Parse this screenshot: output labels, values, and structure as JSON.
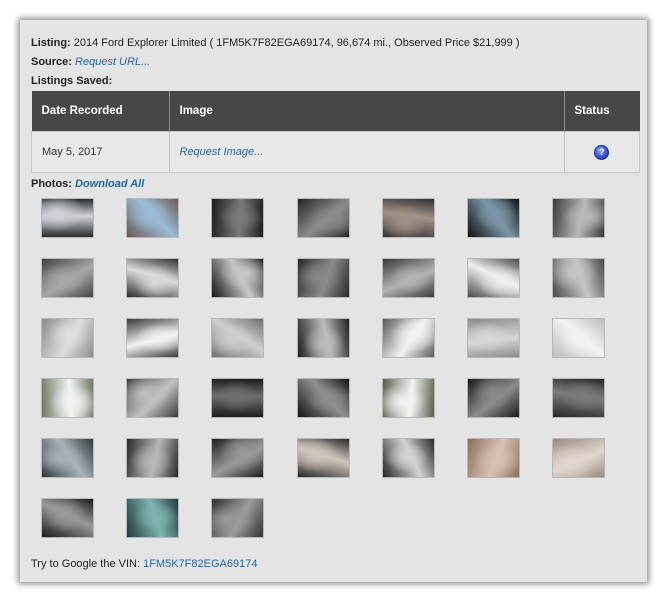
{
  "listing": {
    "label": "Listing:",
    "text": "2014 Ford Explorer Limited ( 1FM5K7F82EGA69174, 96,674 mi., Observed Price $21,999 )"
  },
  "source": {
    "label": "Source:",
    "link": "Request URL..."
  },
  "saved": {
    "label": "Listings Saved:"
  },
  "table": {
    "headers": [
      "Date Recorded",
      "Image",
      "Status"
    ],
    "rows": [
      {
        "date": "May 5, 2017",
        "image_link": "Request Image...",
        "status_icon": "question-icon",
        "status_glyph": "?"
      }
    ]
  },
  "photos": {
    "label": "Photos:",
    "download": "Download All",
    "items": [
      {
        "subject": "ignition-button",
        "c1": "#2a2a2a",
        "c2": "#cfd3d8"
      },
      {
        "subject": "sunroof",
        "c1": "#6a5a52",
        "c2": "#9bbcd6"
      },
      {
        "subject": "door-panel",
        "c1": "#1f1f1f",
        "c2": "#7a7a7a"
      },
      {
        "subject": "door-panel",
        "c1": "#262626",
        "c2": "#8c8c8c"
      },
      {
        "subject": "door-panel",
        "c1": "#333333",
        "c2": "#a29286"
      },
      {
        "subject": "backup-camera-screen",
        "c1": "#111111",
        "c2": "#7c98a8"
      },
      {
        "subject": "rear-seats",
        "c1": "#3a3a3a",
        "c2": "#b9b9b9"
      },
      {
        "subject": "rear-seats",
        "c1": "#444444",
        "c2": "#a8a8a8"
      },
      {
        "subject": "door-open",
        "c1": "#2f2f2f",
        "c2": "#dcdcdc"
      },
      {
        "subject": "gauge-cluster",
        "c1": "#141414",
        "c2": "#c8c8c8"
      },
      {
        "subject": "cabin-interior",
        "c1": "#2b2b2b",
        "c2": "#8a8a8a"
      },
      {
        "subject": "cargo-seats",
        "c1": "#3b3b3b",
        "c2": "#b3b3b3"
      },
      {
        "subject": "rear-exterior",
        "c1": "#4b4b4b",
        "c2": "#efefef"
      },
      {
        "subject": "rear-seats",
        "c1": "#4a4a4a",
        "c2": "#c6c6c6"
      },
      {
        "subject": "cargo-area",
        "c1": "#8d8d8d",
        "c2": "#dedede"
      },
      {
        "subject": "front-exterior",
        "c1": "#3c3c3c",
        "c2": "#f2f2f2"
      },
      {
        "subject": "third-row",
        "c1": "#6e6e6e",
        "c2": "#cfcfcf"
      },
      {
        "subject": "wheel",
        "c1": "#202020",
        "c2": "#bdbdbd"
      },
      {
        "subject": "front-exterior",
        "c1": "#5a5a5a",
        "c2": "#f4f4f4"
      },
      {
        "subject": "rear-seats",
        "c1": "#8c8c8c",
        "c2": "#d7d7d7"
      },
      {
        "subject": "window-sticker",
        "c1": "#bdbdbd",
        "c2": "#f3f3f3"
      },
      {
        "subject": "side-exterior",
        "c1": "#6f7a66",
        "c2": "#f4f4f4"
      },
      {
        "subject": "front-seats",
        "c1": "#3c3c3c",
        "c2": "#c2c2c2"
      },
      {
        "subject": "steering-controls",
        "c1": "#1c1c1c",
        "c2": "#6f6f6f"
      },
      {
        "subject": "center-console",
        "c1": "#151515",
        "c2": "#8f8f8f"
      },
      {
        "subject": "front-exterior",
        "c1": "#59604f",
        "c2": "#f4f4f4"
      },
      {
        "subject": "dashboard",
        "c1": "#1b1b1b",
        "c2": "#8b8b8b"
      },
      {
        "subject": "front-seats",
        "c1": "#282828",
        "c2": "#7b7b7b"
      },
      {
        "subject": "front-seats",
        "c1": "#2f3b3e",
        "c2": "#a9b5b8"
      },
      {
        "subject": "vent-controls",
        "c1": "#2b2b2b",
        "c2": "#b7b7b7"
      },
      {
        "subject": "engine-bay",
        "c1": "#1f1f1f",
        "c2": "#9a9a9a"
      },
      {
        "subject": "dashboard",
        "c1": "#2a2a2a",
        "c2": "#cfc7bc"
      },
      {
        "subject": "dashboard",
        "c1": "#262626",
        "c2": "#d4d4d4"
      },
      {
        "subject": "seat-buttons",
        "c1": "#8e6f5d",
        "c2": "#d8c2b1"
      },
      {
        "subject": "seat-switch",
        "c1": "#9a8a7f",
        "c2": "#e1d7cf"
      },
      {
        "subject": "steering-wheel",
        "c1": "#1b1b1b",
        "c2": "#9a9a9a"
      },
      {
        "subject": "steering-controls",
        "c1": "#1f3d3d",
        "c2": "#7fb4b0"
      },
      {
        "subject": "cargo-area",
        "c1": "#333333",
        "c2": "#9c9c9c"
      }
    ]
  },
  "footer": {
    "text": "Try to Google the VIN:",
    "vin": "1FM5K7F82EGA69174"
  }
}
